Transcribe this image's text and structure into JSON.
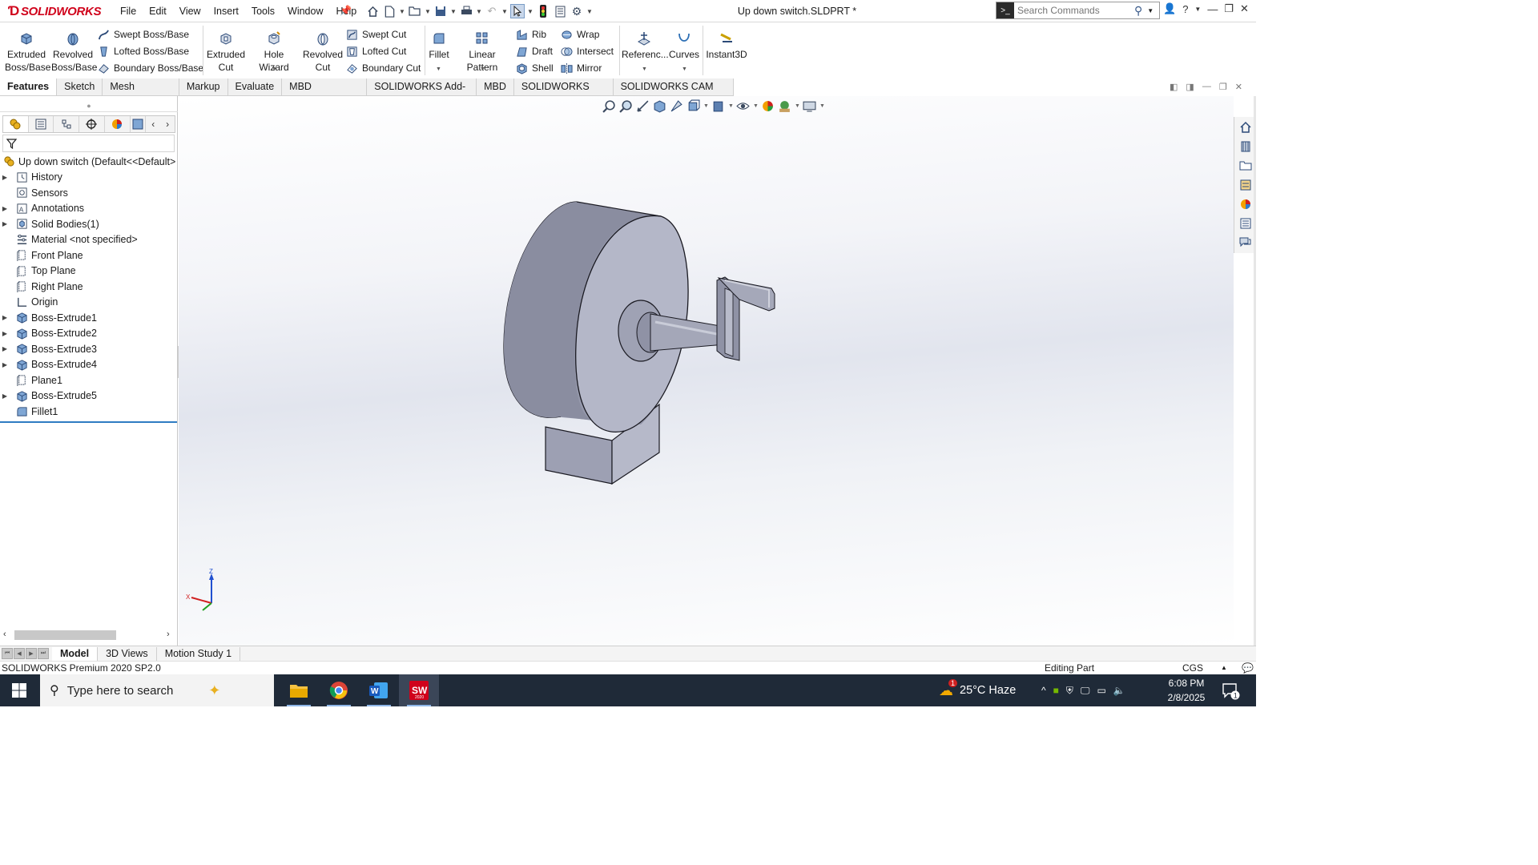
{
  "app": {
    "logo_text": "SOLIDWORKS",
    "document_title": "Up down switch.SLDPRT *"
  },
  "menu": [
    "File",
    "Edit",
    "View",
    "Insert",
    "Tools",
    "Window",
    "Help"
  ],
  "search": {
    "placeholder": "Search Commands"
  },
  "ribbon": {
    "extruded_boss": "Extruded Boss/Base",
    "revolved_boss": "Revolved Boss/Base",
    "swept_boss": "Swept Boss/Base",
    "lofted_boss": "Lofted Boss/Base",
    "boundary_boss": "Boundary Boss/Base",
    "extruded_cut": "Extruded Cut",
    "hole_wizard": "Hole Wizard",
    "revolved_cut": "Revolved Cut",
    "swept_cut": "Swept Cut",
    "lofted_cut": "Lofted Cut",
    "boundary_cut": "Boundary Cut",
    "fillet": "Fillet",
    "linear_pattern": "Linear Pattern",
    "rib": "Rib",
    "draft": "Draft",
    "shell": "Shell",
    "wrap": "Wrap",
    "intersect": "Intersect",
    "mirror": "Mirror",
    "reference": "Referenc...",
    "curves": "Curves",
    "instant3d": "Instant3D"
  },
  "tabs": [
    "Features",
    "Sketch",
    "Mesh Modeling",
    "Markup",
    "Evaluate",
    "MBD Dimensions",
    "SOLIDWORKS Add-Ins",
    "MBD",
    "SOLIDWORKS CAM",
    "SOLIDWORKS CAM TBM"
  ],
  "tree": {
    "root": "Up down switch  (Default<<Default>",
    "items": [
      {
        "label": "History",
        "expand": true
      },
      {
        "label": "Sensors",
        "expand": false
      },
      {
        "label": "Annotations",
        "expand": true
      },
      {
        "label": "Solid Bodies(1)",
        "expand": true
      },
      {
        "label": "Material <not specified>",
        "expand": false
      },
      {
        "label": "Front Plane",
        "expand": false
      },
      {
        "label": "Top Plane",
        "expand": false
      },
      {
        "label": "Right Plane",
        "expand": false
      },
      {
        "label": "Origin",
        "expand": false
      },
      {
        "label": "Boss-Extrude1",
        "expand": true
      },
      {
        "label": "Boss-Extrude2",
        "expand": true
      },
      {
        "label": "Boss-Extrude3",
        "expand": true
      },
      {
        "label": "Boss-Extrude4",
        "expand": true
      },
      {
        "label": "Plane1",
        "expand": false
      },
      {
        "label": "Boss-Extrude5",
        "expand": true
      },
      {
        "label": "Fillet1",
        "expand": false
      }
    ]
  },
  "triad": {
    "z": "Z",
    "x": "X"
  },
  "bottom_tabs": [
    "Model",
    "3D Views",
    "Motion Study 1"
  ],
  "status": {
    "version": "SOLIDWORKS Premium 2020 SP2.0",
    "mode": "Editing Part",
    "units": "CGS"
  },
  "taskbar": {
    "search_placeholder": "Type here to search",
    "weather": "25°C  Haze",
    "time": "6:08 PM",
    "date": "2/8/2025",
    "notification_count": "1",
    "weather_badge": "1",
    "sw_icon_label": "SW",
    "sw_icon_year": "2020"
  }
}
